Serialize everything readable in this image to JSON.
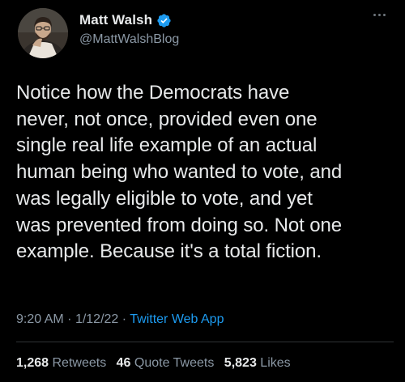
{
  "tweet": {
    "author": {
      "display_name": "Matt Walsh",
      "handle": "@MattWalshBlog",
      "verified": true
    },
    "text": "Notice how the Democrats have\nnever, not once, provided even one\nsingle real life example of an actual\nhuman being who wanted to vote, and\nwas legally eligible to vote, and yet\nwas prevented from doing so. Not one\nexample. Because it's a total fiction.",
    "time": "9:20 AM",
    "separator1": "·",
    "date": "1/12/22",
    "separator2": "·",
    "source": "Twitter Web App",
    "stats": {
      "retweets_count": "1,268",
      "retweets_label": "Retweets",
      "quote_tweets_count": "46",
      "quote_tweets_label": "Quote Tweets",
      "likes_count": "5,823",
      "likes_label": "Likes"
    }
  },
  "icons": {
    "verified": "verified-badge-icon",
    "more": "more-options-icon",
    "avatar": "profile-avatar"
  },
  "colors": {
    "background": "#000000",
    "text_primary": "#e7e9ea",
    "text_secondary": "#8b98a5",
    "link": "#1d9bf0",
    "verified": "#1d9bf0"
  }
}
